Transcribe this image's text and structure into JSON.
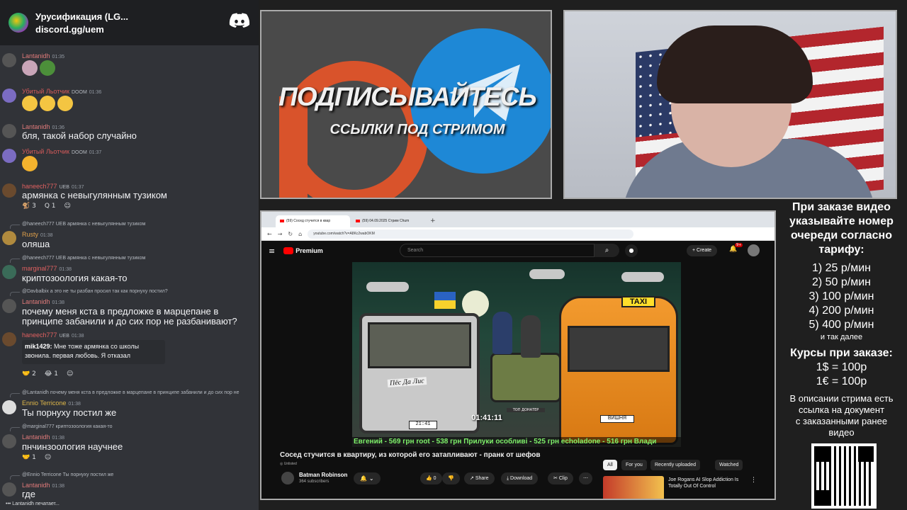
{
  "chat": {
    "server_name": "Урусификация (LG...",
    "server_link": "discord.gg/uem",
    "messages": [
      {
        "user": "Lantanidh",
        "time": "01:35",
        "text": ""
      },
      {
        "user": "Убитый Льотчик",
        "badge": "DOOM",
        "time": "01:36",
        "text": ""
      },
      {
        "user": "Lantanidh",
        "time": "01:36",
        "text": "бля, такой набор случайно"
      },
      {
        "user": "Убитый Льотчик",
        "badge": "DOOM",
        "time": "01:37",
        "text": ""
      },
      {
        "user": "haneech777",
        "badge": "UEB",
        "time": "01:37",
        "text": "армянка с невыгулянным тузиком",
        "reactions": [
          "3",
          "1"
        ]
      },
      {
        "reply_user": "@haneech777",
        "reply_badge": "UEB",
        "reply_text": "армянка с невыгулянным тузиком",
        "user": "Rusty",
        "time": "01:38",
        "text": "оляша"
      },
      {
        "reply_user": "@haneech777",
        "reply_badge": "UEB",
        "reply_text": "армянка с невыгулянным тузиком",
        "user": "marginal777",
        "time": "01:38",
        "text": "криптозоология какая-то"
      },
      {
        "reply_user": "@Davbalbix",
        "reply_text": "а это не ты разбан просил так как порнуху постил?",
        "user": "Lantanidh",
        "time": "01:38",
        "text": "почему меня кста в предложке в марцепане в",
        "text2": "принципе забанили и до сих пор не разбанивают?"
      },
      {
        "user": "haneech777",
        "badge": "UEB",
        "time": "01:38",
        "quote_user": "mik1429:",
        "quote_text": "Мне тоже армянка со школы",
        "quote_text2": "звонила. первая любовь. Я отказал",
        "reactions": [
          "2",
          "1"
        ]
      },
      {
        "reply_user": "@Lantanidh",
        "reply_text": "почему меня кста в предложке в марцепане в принципе забанили и до сих пор не",
        "user": "Ennio Terricone",
        "time": "01:38",
        "text": "Ты порнуху постил же"
      },
      {
        "reply_user": "@marginal777",
        "reply_text": "криптозоология какая-то",
        "user": "Lantanidh",
        "time": "01:38",
        "text": "пнчинзоология научнее",
        "reactions": [
          "1"
        ]
      },
      {
        "reply_user": "@Ennio Terricone",
        "reply_text": "Ты порнуху постил же",
        "user": "Lantanidh",
        "time": "01:38",
        "text": "где"
      }
    ],
    "typing": "Lantanidh печатает..."
  },
  "promo": {
    "title": "ПОДПИСЫВАЙТЕСЬ",
    "subtitle": "ССЫЛКИ ПОД СТРИМОМ"
  },
  "browser": {
    "tabs": [
      "(59) Сосед стучится в квар",
      "(59) 04.09.2025 Стрим Chum"
    ],
    "url": "youtube.com/watch?v=A8Kc2wabOKM",
    "brand": "Premium",
    "search_placeholder": "Search",
    "create_label": "Create",
    "notif_count": "9+",
    "player": {
      "time": "01:41:11",
      "sign": "Пёс Да Лис",
      "plate_left": "21:41",
      "plate_van": "ВИШНЯ",
      "taxi": "TAXI",
      "donor_label": "ТОП ДОНАТЕР",
      "ticker": "Евгений - 569 грн   root - 538 грн   Прилуки особливі - 525 грн   echoladone - 516 грн   Влади"
    },
    "video_title": "Сосед стучится в квартиру, из которой его затапливают - пранк от шефов",
    "unlisted": "Unlisted",
    "channel_name": "Batman Robinson",
    "channel_subs": "364 subscribers",
    "likes": "0",
    "share_label": "Share",
    "download_label": "Download",
    "clip_label": "Clip",
    "chips": [
      "All",
      "For you",
      "Recently uploaded",
      "Watched"
    ],
    "rec_title": "Joe Rogans AI Slop Addiction Is Totally Out Of Control"
  },
  "info": {
    "line1": "При заказе видео",
    "line2": "указывайте номер",
    "line3": "очереди согласно",
    "line4": "тарифу:",
    "tariffs": [
      "1) 25 р/мин",
      "2) 50 р/мин",
      "3) 100 р/мин",
      "4) 200 р/мин",
      "5) 400 р/мин"
    ],
    "etc": "и так далее",
    "rates_title": "Курсы при заказе:",
    "rate1": "1$ = 100р",
    "rate2": "1€ = 100р",
    "desc1": "В описании стрима есть",
    "desc2": "ссылка на документ",
    "desc3": "с заказанными ранее",
    "desc4": "видео"
  },
  "colors": {
    "discord_bg": "#313338",
    "accent_red": "#d9532b",
    "telegram_blue": "#1e88d6",
    "ticker_green": "#7ef06a"
  }
}
